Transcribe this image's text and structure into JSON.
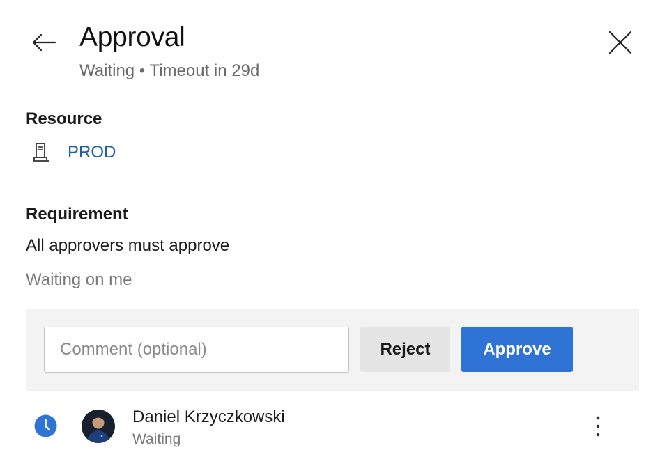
{
  "header": {
    "title": "Approval",
    "subtitle": "Waiting • Timeout in 29d",
    "back_icon": "arrow-left-icon",
    "close_icon": "close-icon"
  },
  "resource": {
    "heading": "Resource",
    "icon": "server-environment-icon",
    "name": "PROD"
  },
  "requirement": {
    "heading": "Requirement",
    "text": "All approvers must approve",
    "status": "Waiting on me"
  },
  "actions": {
    "comment_placeholder": "Comment (optional)",
    "comment_value": "",
    "reject_label": "Reject",
    "approve_label": "Approve"
  },
  "approvers": [
    {
      "name": "Daniel Krzyczkowski",
      "status": "Waiting",
      "status_icon": "clock-icon",
      "avatar": "user-avatar",
      "menu_icon": "more-vertical-icon"
    }
  ],
  "colors": {
    "accent": "#2f73d4",
    "link": "#1e5ea8",
    "panel_bg": "#f3f3f3",
    "secondary_button_bg": "#e5e5e5",
    "muted_text": "#7a7a7a"
  }
}
